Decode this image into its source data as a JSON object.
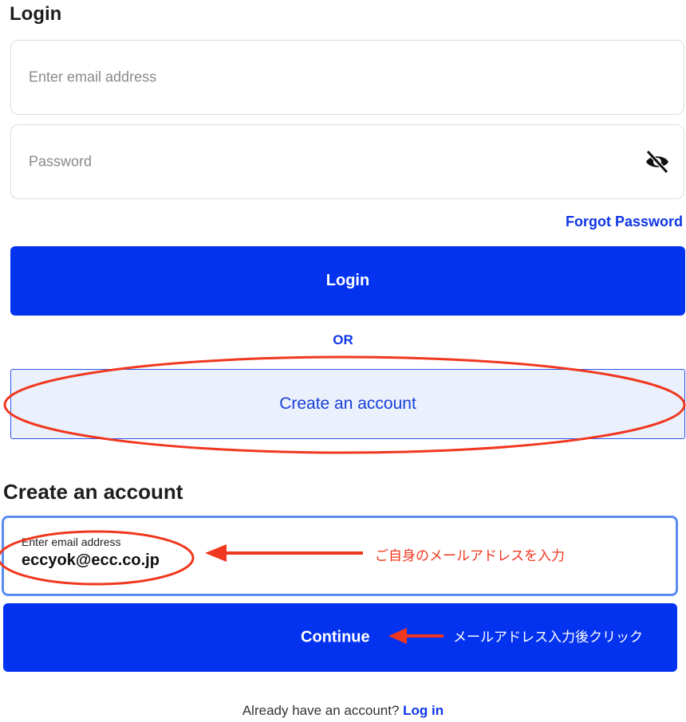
{
  "login": {
    "title": "Login",
    "email_placeholder": "Enter email address",
    "password_placeholder": "Password",
    "password_toggle_icon": "eye-off-icon",
    "forgot_password": "Forgot Password",
    "login_button": "Login",
    "or_text": "OR",
    "create_account_button": "Create an account"
  },
  "create_account": {
    "title": "Create an account",
    "email_label": "Enter email address",
    "email_value": "eccyok@ecc.co.jp",
    "continue_button": "Continue"
  },
  "annotations": {
    "email_note": "ご自身のメールアドレスを入力",
    "continue_note": "メールアドレス入力後クリック",
    "color": "#f0371f"
  },
  "footer": {
    "prompt": "Already have an account? ",
    "link": "Log in"
  },
  "colors": {
    "primary": "#0433f0",
    "link": "#0d35e6",
    "secondary_bg": "#eaf0fc"
  }
}
